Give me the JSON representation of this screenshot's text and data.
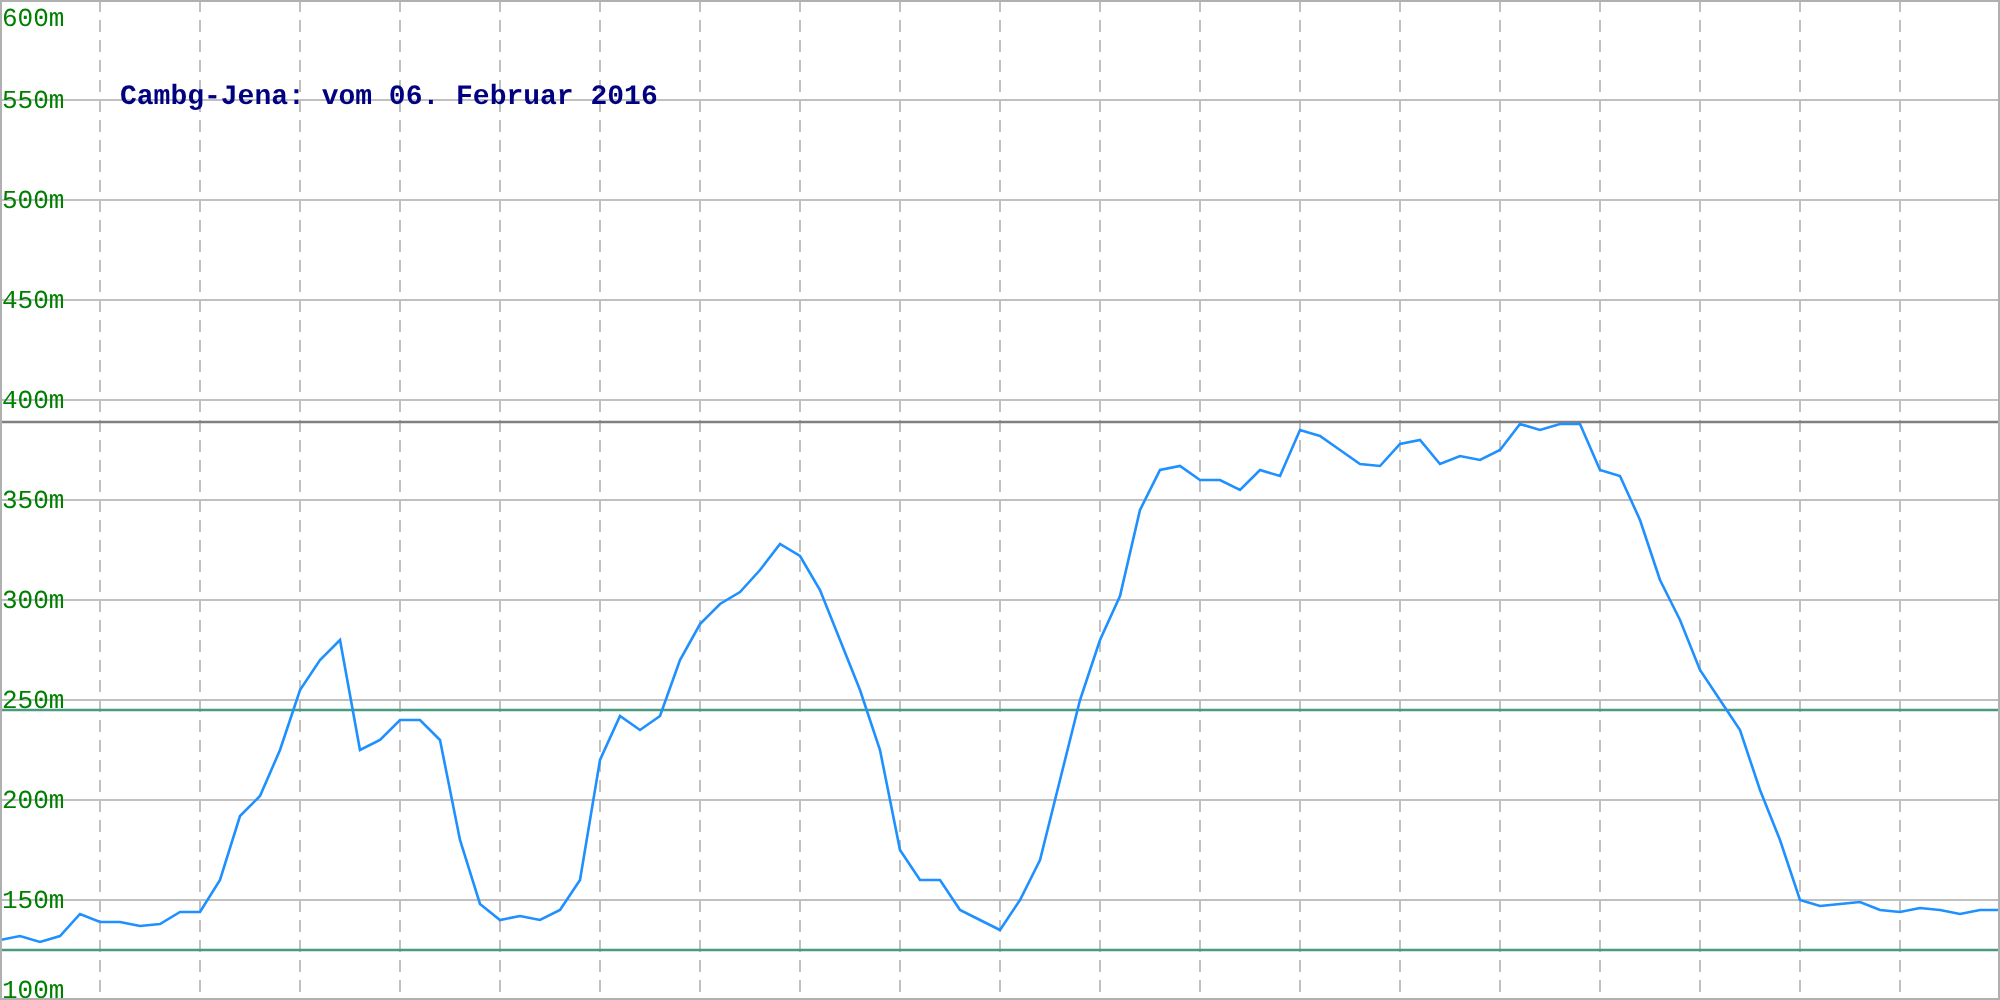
{
  "chart_data": {
    "type": "line",
    "title": "Cambg-Jena: vom 06. Februar 2016",
    "ylim": [
      100,
      600
    ],
    "yticks": [
      {
        "value": 100,
        "label": "100m"
      },
      {
        "value": 150,
        "label": "150m"
      },
      {
        "value": 200,
        "label": "200m"
      },
      {
        "value": 250,
        "label": "250m"
      },
      {
        "value": 300,
        "label": "300m"
      },
      {
        "value": 350,
        "label": "350m"
      },
      {
        "value": 400,
        "label": "400m"
      },
      {
        "value": 450,
        "label": "450m"
      },
      {
        "value": 500,
        "label": "500m"
      },
      {
        "value": 550,
        "label": "550m"
      },
      {
        "value": 600,
        "label": "600m"
      }
    ],
    "series": [
      {
        "color": "#1e90ff",
        "values": [
          130,
          132,
          129,
          132,
          143,
          139,
          139,
          137,
          138,
          144,
          144,
          160,
          192,
          202,
          225,
          255,
          270,
          280,
          225,
          230,
          240,
          240,
          230,
          180,
          148,
          140,
          142,
          140,
          145,
          160,
          220,
          242,
          235,
          242,
          270,
          288,
          298,
          304,
          315,
          328,
          322,
          305,
          280,
          255,
          225,
          175,
          160,
          160,
          145,
          140,
          135,
          150,
          170,
          210,
          250,
          280,
          302,
          345,
          365,
          367,
          360,
          360,
          355,
          365,
          362,
          385,
          382,
          375,
          368,
          367,
          378,
          380,
          368,
          372,
          370,
          375,
          388,
          385,
          388,
          388,
          365,
          362,
          340,
          310,
          290,
          265,
          250,
          235,
          205,
          180,
          150,
          147,
          148,
          149,
          145,
          144,
          146,
          145,
          143,
          145,
          145
        ]
      }
    ],
    "grid": true,
    "ref_lines": [
      {
        "axis": "y",
        "value": 389,
        "color": "#808080"
      },
      {
        "axis": "y",
        "value": 245,
        "color": "#4a9a80"
      },
      {
        "axis": "y",
        "value": 125,
        "color": "#4a9a80"
      }
    ]
  }
}
